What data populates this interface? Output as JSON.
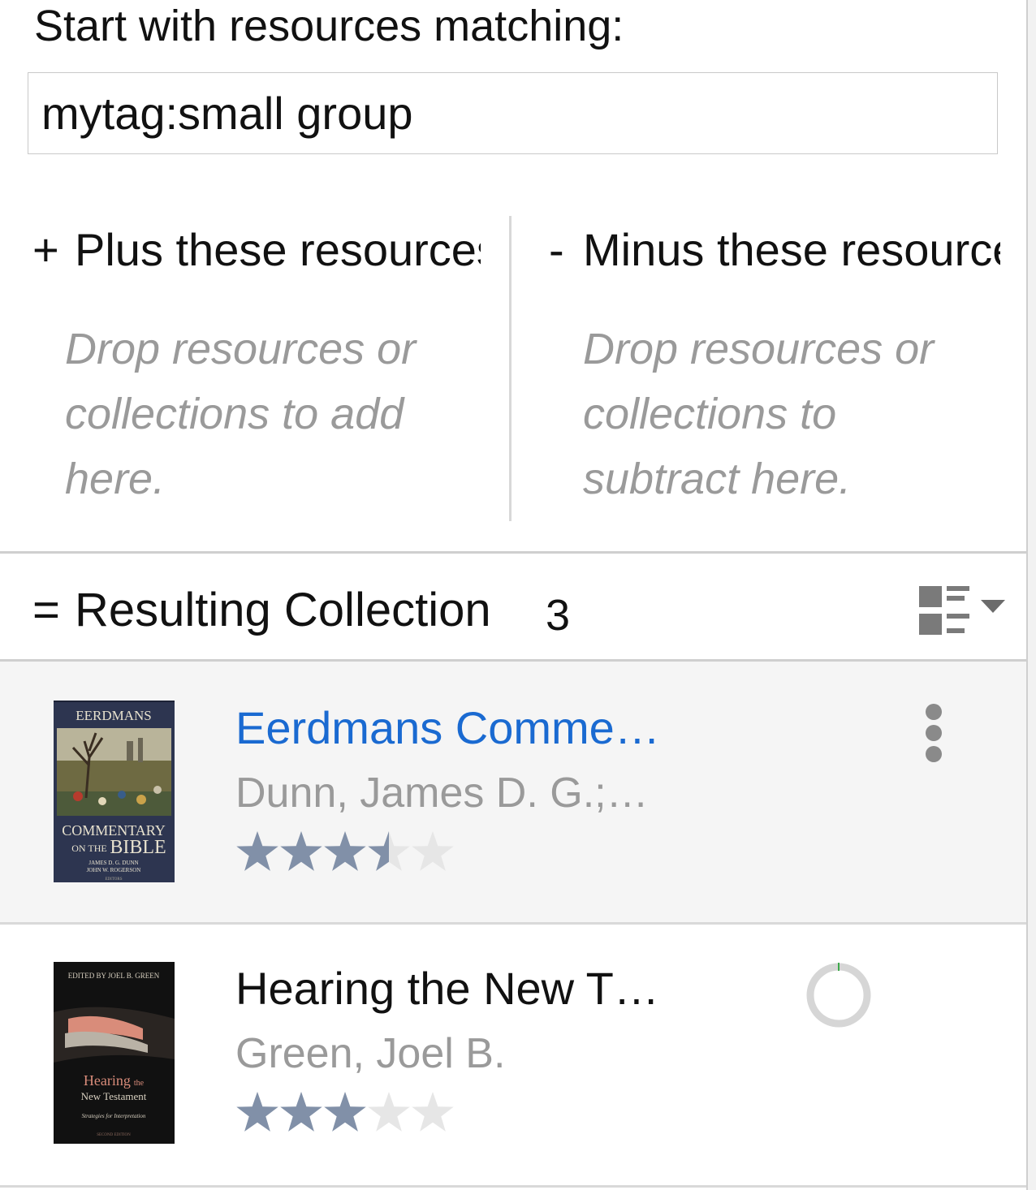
{
  "filter": {
    "start_label": "Start with resources matching:",
    "query_value": "mytag:small group",
    "plus": {
      "symbol": "+",
      "header": "Plus these resources",
      "hint": "Drop resources or collections to add here."
    },
    "minus": {
      "symbol": "-",
      "header": "Minus these resources",
      "hint": "Drop resources or collections to subtract here."
    }
  },
  "result": {
    "symbol": "=",
    "label": "Resulting Collection",
    "count": "3",
    "view_icon": "list-view-icon"
  },
  "items": [
    {
      "title": "Eerdmans Comme…",
      "author": "Dunn, James D. G.;…",
      "rating": 3.5,
      "selected": true,
      "action_icon": "more-vertical-icon",
      "cover": {
        "publisher": "EERDMANS",
        "line1": "COMMENTARY",
        "line2_small": "ON THE",
        "line2_big": "BIBLE",
        "authors1": "JAMES D. G. DUNN",
        "authors2": "JOHN W. ROGERSON",
        "footer": "EDITORS"
      }
    },
    {
      "title": "Hearing the New T…",
      "author": "Green, Joel B.",
      "rating": 3,
      "selected": false,
      "action_icon": "download-progress-icon",
      "cover": {
        "top": "EDITED BY JOEL B. GREEN",
        "title_main": "Hearing",
        "title_small": "the",
        "title_sub": "New Testament",
        "subtitle": "Strategies for Interpretation",
        "edition": "SECOND EDITION"
      }
    }
  ],
  "colors": {
    "link": "#1a6ad1",
    "muted": "#9a9a9a",
    "star_filled": "#8190a8",
    "star_empty": "#e6e6e6",
    "selected_row": "#f5f5f5"
  }
}
